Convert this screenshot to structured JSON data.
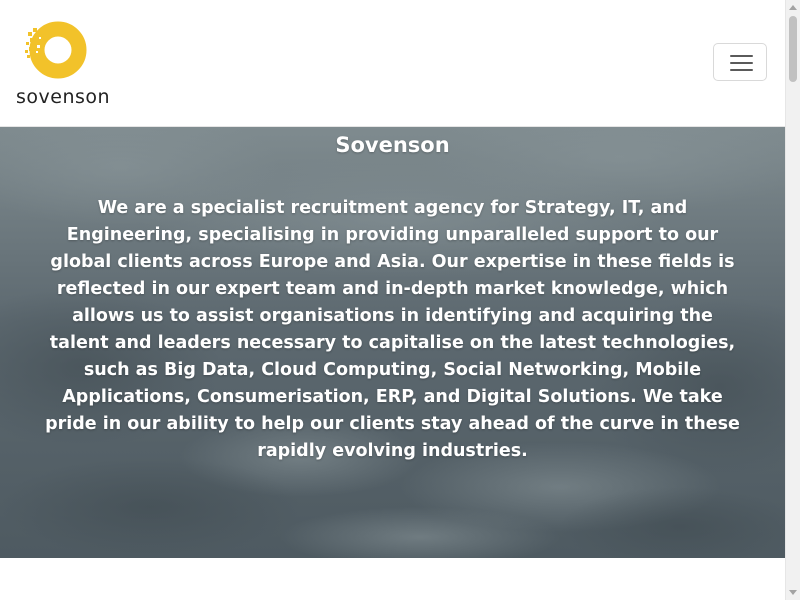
{
  "header": {
    "brand_name": "sovenson",
    "logo_icon": "sovenson-logo-icon",
    "menu_icon": "hamburger-menu-icon"
  },
  "hero": {
    "title": "Sovenson",
    "text": "We are a specialist recruitment agency for Strategy, IT, and Engineering, specialising in providing unparalleled support to our global clients across Europe and Asia. Our expertise in these fields is reflected in our expert team and in-depth market knowledge, which allows us to assist organisations in identifying and acquiring the talent and leaders necessary to capitalise on the latest technologies, such as Big Data, Cloud Computing, Social Networking, Mobile Applications, Consumerisation, ERP, and Digital Solutions. We take pride in our ability to help our clients stay ahead of the curve in these rapidly evolving industries."
  },
  "colors": {
    "brand_yellow": "#F2C22A",
    "hero_overlay": "#5E6B72",
    "text_on_hero": "#FFFFFF"
  }
}
